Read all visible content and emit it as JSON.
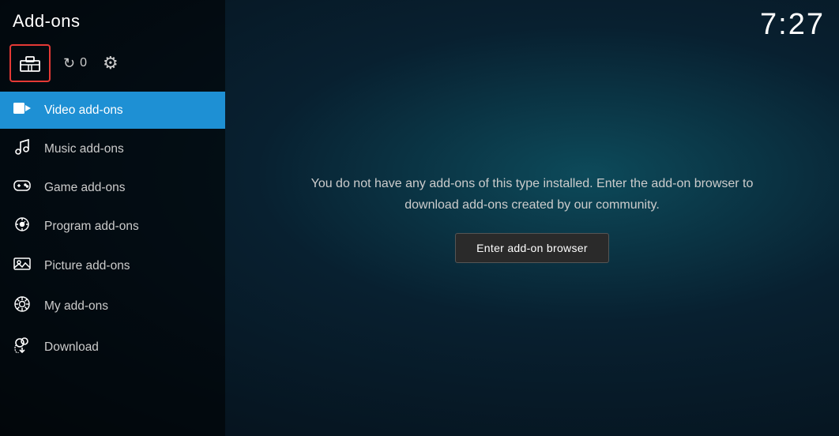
{
  "header": {
    "title": "Add-ons",
    "time": "7:27"
  },
  "iconBar": {
    "refreshCount": "0",
    "addonBoxLabel": "addon-box"
  },
  "nav": {
    "items": [
      {
        "id": "video",
        "label": "Video add-ons",
        "icon": "video",
        "active": true
      },
      {
        "id": "music",
        "label": "Music add-ons",
        "icon": "music",
        "active": false
      },
      {
        "id": "game",
        "label": "Game add-ons",
        "icon": "game",
        "active": false
      },
      {
        "id": "program",
        "label": "Program add-ons",
        "icon": "program",
        "active": false
      },
      {
        "id": "picture",
        "label": "Picture add-ons",
        "icon": "picture",
        "active": false
      },
      {
        "id": "myaddon",
        "label": "My add-ons",
        "icon": "myaddon",
        "active": false
      },
      {
        "id": "download",
        "label": "Download",
        "icon": "download",
        "active": false
      }
    ]
  },
  "main": {
    "emptyMessage": "You do not have any add-ons of this type installed. Enter the add-on browser to download add-ons created by our community.",
    "browserButtonLabel": "Enter add-on browser"
  }
}
